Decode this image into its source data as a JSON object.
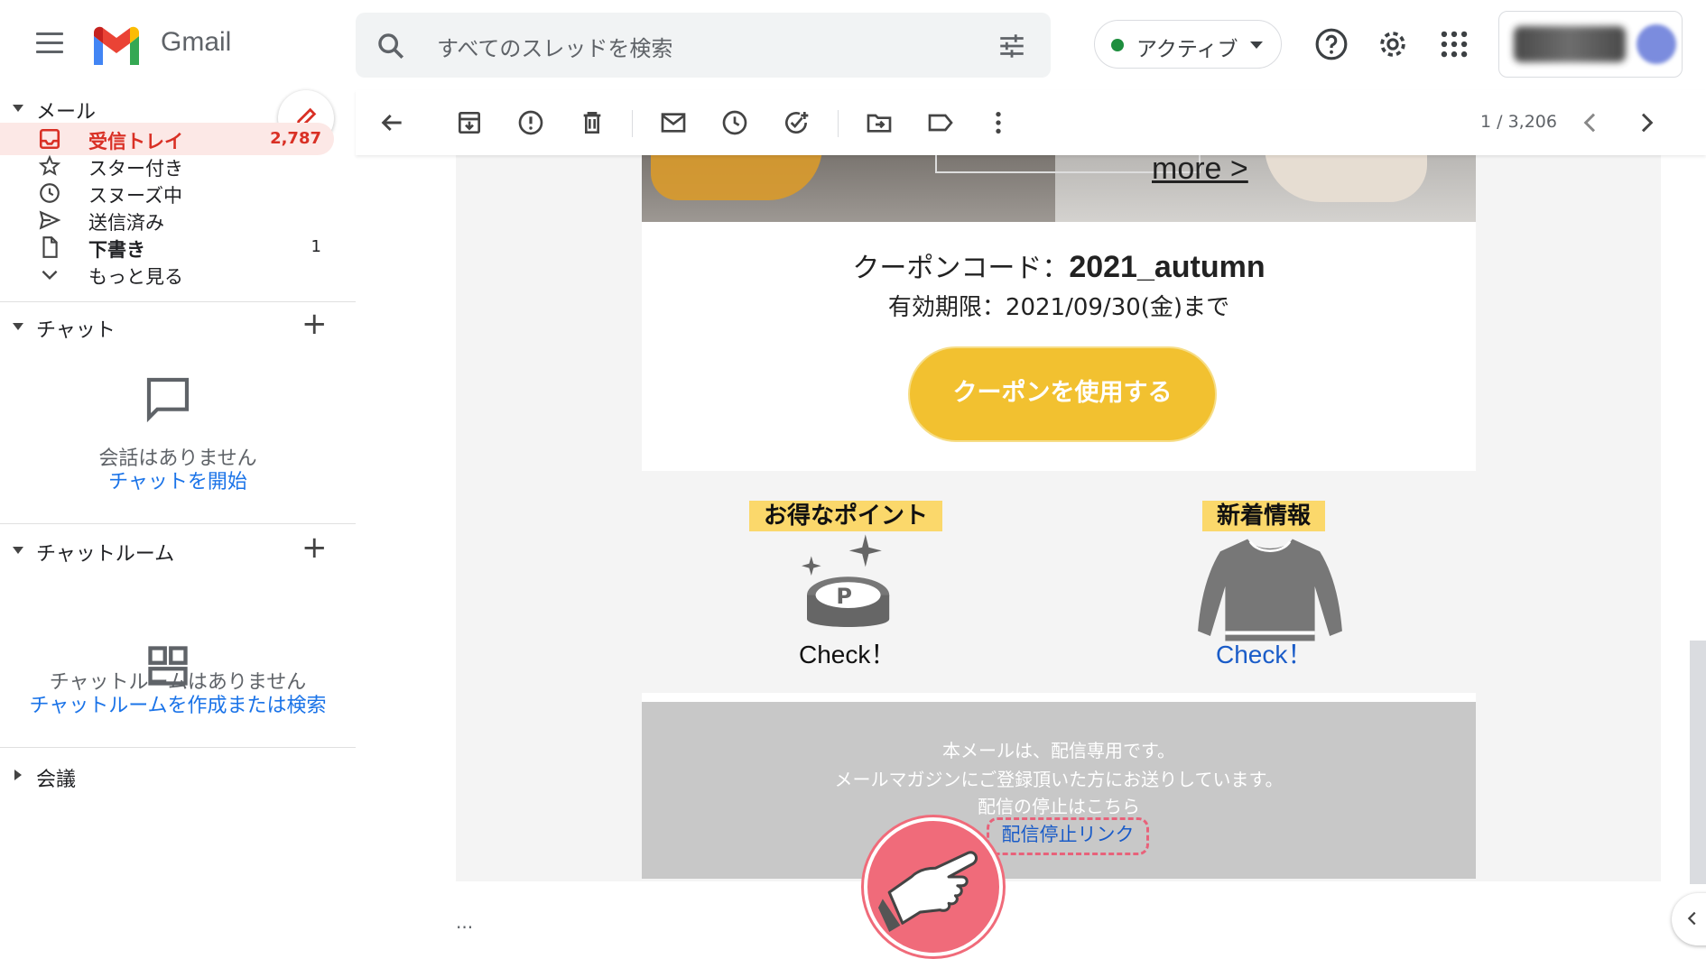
{
  "app": {
    "name": "Gmail"
  },
  "search": {
    "placeholder": "すべてのスレッドを検索"
  },
  "status": {
    "label": "アクティブ",
    "color": "#1e8e3e"
  },
  "sidebar": {
    "mail_section": "メール",
    "items": [
      {
        "label": "受信トレイ",
        "count": "2,787",
        "icon": "inbox-icon"
      },
      {
        "label": "スター付き",
        "count": "",
        "icon": "star-icon"
      },
      {
        "label": "スヌーズ中",
        "count": "",
        "icon": "clock-icon"
      },
      {
        "label": "送信済み",
        "count": "",
        "icon": "send-icon"
      },
      {
        "label": "下書き",
        "count": "1",
        "icon": "draft-icon"
      },
      {
        "label": "もっと見る",
        "count": "",
        "icon": "chevron-down-icon"
      }
    ],
    "chat_section": "チャット",
    "chat_empty": "会話はありません",
    "chat_start": "チャットを開始",
    "rooms_section": "チャットルーム",
    "rooms_empty": "チャットルームはありません",
    "rooms_create": "チャットルームを作成または検索",
    "meet_section": "会議"
  },
  "toolbar": {
    "pager": "1 / 3,206"
  },
  "email": {
    "hero_more": "more >",
    "coupon_prefix": "クーポンコード：",
    "coupon_code": "2021_autumn",
    "expiry": "有効期限：2021/09/30(金)まで",
    "coupon_button": "クーポンを使用する",
    "feature_points": {
      "title": "お得なポイント",
      "link": "Check！"
    },
    "feature_news": {
      "title": "新着情報",
      "link": "Check！"
    },
    "footer_line1": "本メールは、配信専用です。",
    "footer_line2": "メールマガジンにご登録頂いた方にお送りしています。",
    "footer_line3": "配信の停止はこちら",
    "unsubscribe_link": "配信停止リンク"
  },
  "footer_ellipsis": "...",
  "colors": {
    "accent_red": "#d93025",
    "coupon_yellow": "#f2c130",
    "link_blue": "#1a73e8",
    "highlight_pink": "#e8627a"
  }
}
